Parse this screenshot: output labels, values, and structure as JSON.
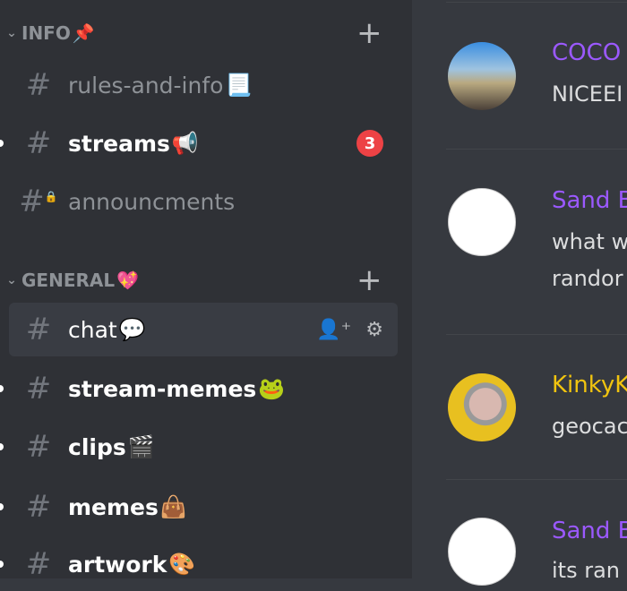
{
  "sidebar": {
    "categories": [
      {
        "label": "INFO",
        "emoji": "📌"
      },
      {
        "label": "GENERAL",
        "emoji": "💖"
      }
    ],
    "channels": [
      {
        "name": "rules-and-info",
        "emoji": "📃"
      },
      {
        "name": "streams",
        "emoji": "📢",
        "badge": "3"
      },
      {
        "name": "announcments",
        "emoji": ""
      },
      {
        "name": "chat",
        "emoji": "💬"
      },
      {
        "name": "stream-memes",
        "emoji": "🐸"
      },
      {
        "name": "clips",
        "emoji": "🎬"
      },
      {
        "name": "memes",
        "emoji": "👜"
      },
      {
        "name": "artwork",
        "emoji": "🎨"
      }
    ]
  },
  "messages": [
    {
      "author": "COCO",
      "color": "#9b59ff",
      "text": [
        "NICEEI"
      ]
    },
    {
      "author": "Sand B",
      "color": "#9b59ff",
      "text": [
        "what w",
        "randor"
      ]
    },
    {
      "author": "KinkyK",
      "color": "#f1c40f",
      "text": [
        "geocac"
      ]
    },
    {
      "author": "Sand B",
      "color": "#9b59ff",
      "text": [
        "its ran"
      ]
    }
  ]
}
